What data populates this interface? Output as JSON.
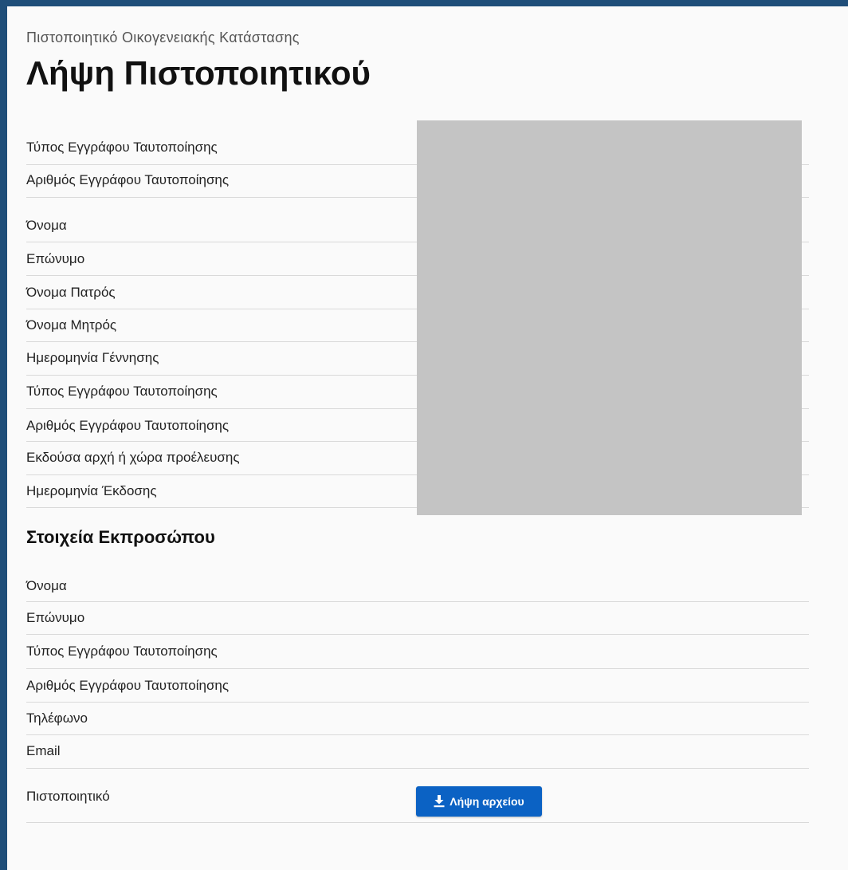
{
  "header": {
    "caption": "Πιστοποιητικό Οικογενειακής Κατάστασης",
    "title": "Λήψη Πιστοποιητικού"
  },
  "applicant": {
    "id_rows": [
      {
        "label": "Τύπος Εγγράφου Ταυτοποίησης"
      },
      {
        "label": "Αριθμός Εγγράφου Ταυτοποίησης"
      }
    ],
    "person_rows": [
      {
        "label": "Όνομα"
      },
      {
        "label": "Επώνυμο"
      },
      {
        "label": "Όνομα Πατρός"
      },
      {
        "label": "Όνομα Μητρός"
      },
      {
        "label": "Ημερομηνία Γέννησης"
      },
      {
        "label": "Τύπος Εγγράφου Ταυτοποίησης"
      },
      {
        "label": "Αριθμός Εγγράφου Ταυτοποίησης"
      },
      {
        "label": "Εκδούσα αρχή ή χώρα προέλευσης"
      },
      {
        "label": "Ημερομηνία Έκδοσης"
      }
    ]
  },
  "representative": {
    "section_title": "Στοιχεία Εκπροσώπου",
    "rows": [
      {
        "label": "Όνομα"
      },
      {
        "label": "Επώνυμο"
      },
      {
        "label": "Τύπος Εγγράφου Ταυτοποίησης"
      },
      {
        "label": "Αριθμός Εγγράφου Ταυτοποίησης"
      },
      {
        "label": "Τηλέφωνο"
      },
      {
        "label": "Email"
      }
    ]
  },
  "certificate": {
    "label": "Πιστοποιητικό",
    "download_button": "Λήψη αρχείου",
    "button_icon": "download-icon"
  },
  "colors": {
    "border": "#1f4e79",
    "button": "#0b62c4",
    "redacted": "#c4c4c4"
  }
}
